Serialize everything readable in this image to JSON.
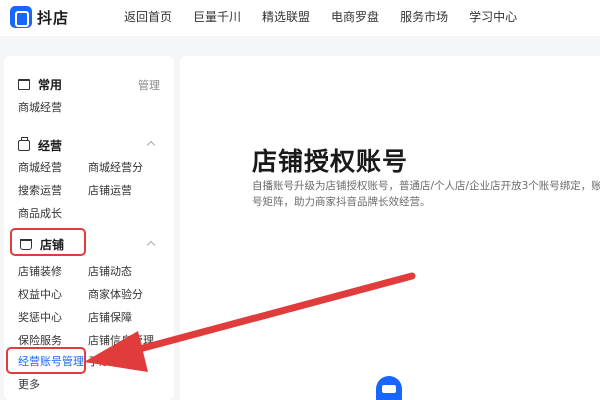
{
  "header": {
    "logo_text": "抖店",
    "nav": [
      "返回首页",
      "巨量千川",
      "精选联盟",
      "电商罗盘",
      "服务市场",
      "学习中心"
    ]
  },
  "sidebar": {
    "common": {
      "title": "常用",
      "action": "管理",
      "items": [
        "商城经营"
      ]
    },
    "operate": {
      "title": "经营",
      "items": [
        "商城经营",
        "商城经营分",
        "搜索运营",
        "店铺运营",
        "商品成长"
      ]
    },
    "store": {
      "title": "店铺",
      "items": [
        "店铺装修",
        "店铺动态",
        "权益中心",
        "商家体验分",
        "奖惩中心",
        "店铺保障",
        "保险服务",
        "店铺信息管理",
        "经营账号管理",
        "子账号管理"
      ],
      "more": "更多"
    }
  },
  "main": {
    "title": "店铺授权账号",
    "description": "自播账号升级为店铺授权账号，普通店/个人店/企业店开放3个账号绑定，账号矩阵，助力商家抖音品牌长效经营。"
  },
  "annotation": {
    "color": "#e03c3c"
  },
  "accent_color": "#1966ff"
}
